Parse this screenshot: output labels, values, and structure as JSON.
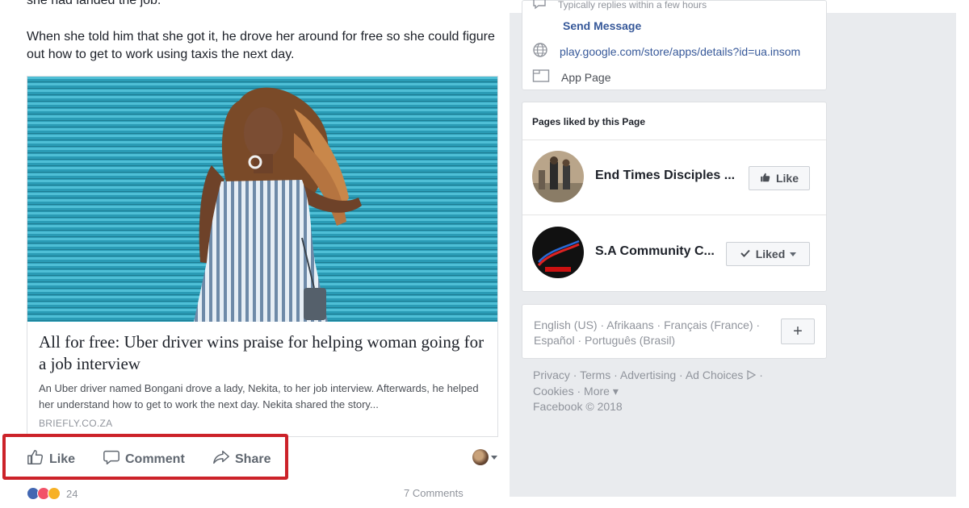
{
  "post": {
    "text_cutoff": "she had landed the job.",
    "paragraph": "When she told him that she got it, he drove her around for free so she could figure out how to get to work using taxis the next day.",
    "link": {
      "title": "All for free: Uber driver wins praise for helping woman going for a job interview",
      "description": "An Uber driver named Bongani drove a lady, Nekita, to her job interview. Afterwards, he helped her understand how to get to work the next day. Nekita shared the story...",
      "domain": "BRIEFLY.CO.ZA"
    },
    "actions": {
      "like": "Like",
      "comment": "Comment",
      "share": "Share"
    },
    "reactions": {
      "count": "24",
      "comments": "7 Comments"
    },
    "highlight_color": "#cc2229"
  },
  "sidebar": {
    "about": {
      "response_cut": "Typically replies within a few hours",
      "send_message": "Send Message",
      "app_url": "play.google.com/store/apps/details?id=ua.insom",
      "app_page": "App Page"
    },
    "pages_liked": {
      "heading": "Pages liked by this Page",
      "items": [
        {
          "name": "End Times Disciples ...",
          "button": "Like"
        },
        {
          "name": "S.A Community C...",
          "button": "Liked"
        }
      ]
    },
    "languages": {
      "current": "English (US)",
      "others": [
        "Afrikaans",
        "Français (France)",
        "Español",
        "Português (Brasil)"
      ],
      "plus": "+"
    },
    "footer": {
      "links": [
        "Privacy",
        "Terms",
        "Advertising",
        "Ad Choices",
        "Cookies",
        "More"
      ],
      "copyright": "Facebook © 2018"
    }
  },
  "colors": {
    "link_blue": "#365899",
    "page_bg": "#e9ebee",
    "muted": "#90949c"
  }
}
